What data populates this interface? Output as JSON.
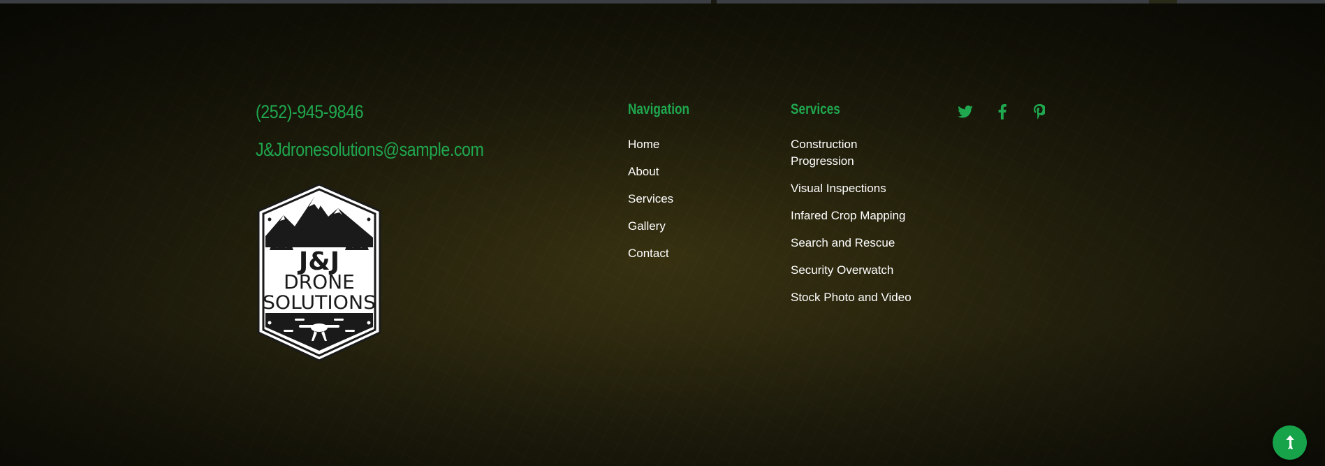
{
  "contact": {
    "phone": "(252)-945-9846",
    "email": "J&Jdronesolutions@sample.com"
  },
  "logo": {
    "line1": "J&J",
    "line2": "DRONE",
    "line3": "SOLUTIONS"
  },
  "navigation": {
    "heading": "Navigation",
    "items": [
      "Home",
      "About",
      "Services",
      "Gallery",
      "Contact"
    ]
  },
  "services": {
    "heading": "Services",
    "items": [
      "Construction Progression",
      "Visual Inspections",
      "Infared Crop Mapping",
      "Search and Rescue",
      "Security Overwatch",
      "Stock Photo and Video"
    ]
  },
  "social": [
    "twitter-icon",
    "facebook-icon",
    "pinterest-icon"
  ],
  "colors": {
    "accent": "#1fa84f",
    "back_to_top": "#17a34a",
    "text": "#ffffff"
  }
}
